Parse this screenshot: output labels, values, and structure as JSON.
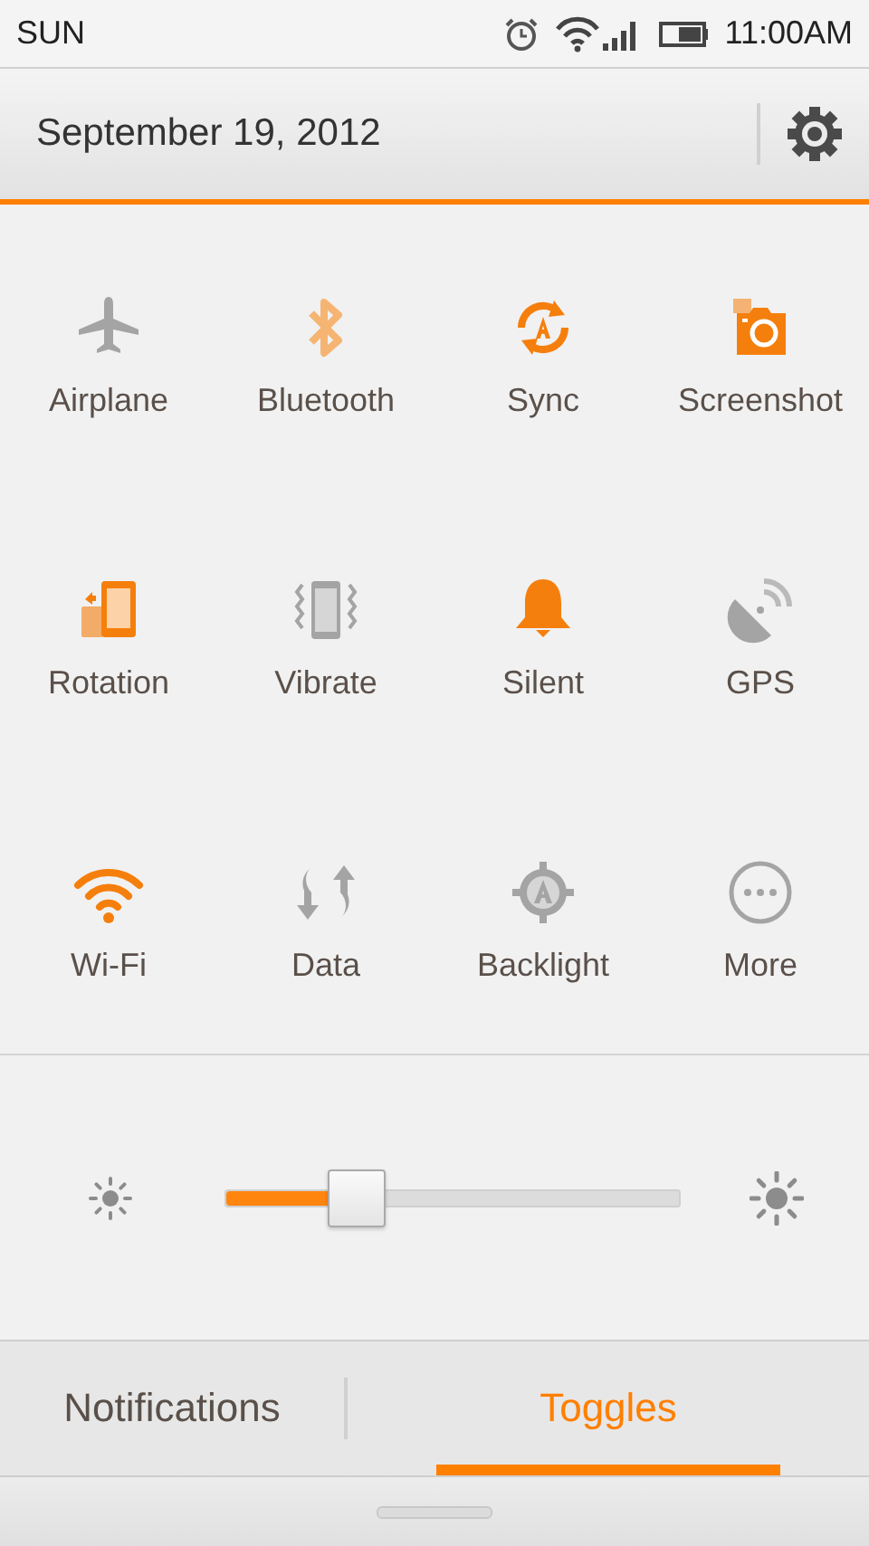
{
  "status_bar": {
    "carrier": "SUN",
    "time": "11:00AM"
  },
  "header": {
    "date": "September 19, 2012"
  },
  "toggles": [
    {
      "label": "Airplane",
      "kind": "airplane",
      "on": false,
      "turning_on": false
    },
    {
      "label": "Bluetooth",
      "kind": "bluetooth",
      "on": false,
      "turning_on": true
    },
    {
      "label": "Sync",
      "kind": "sync",
      "on": true,
      "turning_on": false
    },
    {
      "label": "Screenshot",
      "kind": "camera",
      "on": true,
      "turning_on": false
    },
    {
      "label": "Rotation",
      "kind": "rotation",
      "on": true,
      "turning_on": false
    },
    {
      "label": "Vibrate",
      "kind": "vibrate",
      "on": false,
      "turning_on": false
    },
    {
      "label": "Silent",
      "kind": "bell",
      "on": true,
      "turning_on": false
    },
    {
      "label": "GPS",
      "kind": "gps",
      "on": false,
      "turning_on": false
    },
    {
      "label": "Wi-Fi",
      "kind": "wifi",
      "on": true,
      "turning_on": false
    },
    {
      "label": "Data",
      "kind": "data",
      "on": false,
      "turning_on": false
    },
    {
      "label": "Backlight",
      "kind": "backlight",
      "on": false,
      "turning_on": false
    },
    {
      "label": "More",
      "kind": "more",
      "on": false,
      "turning_on": false
    }
  ],
  "brightness": {
    "level": 0.29
  },
  "tabs": [
    {
      "label": "Notifications",
      "selected": false
    },
    {
      "label": "Toggles",
      "selected": true
    }
  ]
}
